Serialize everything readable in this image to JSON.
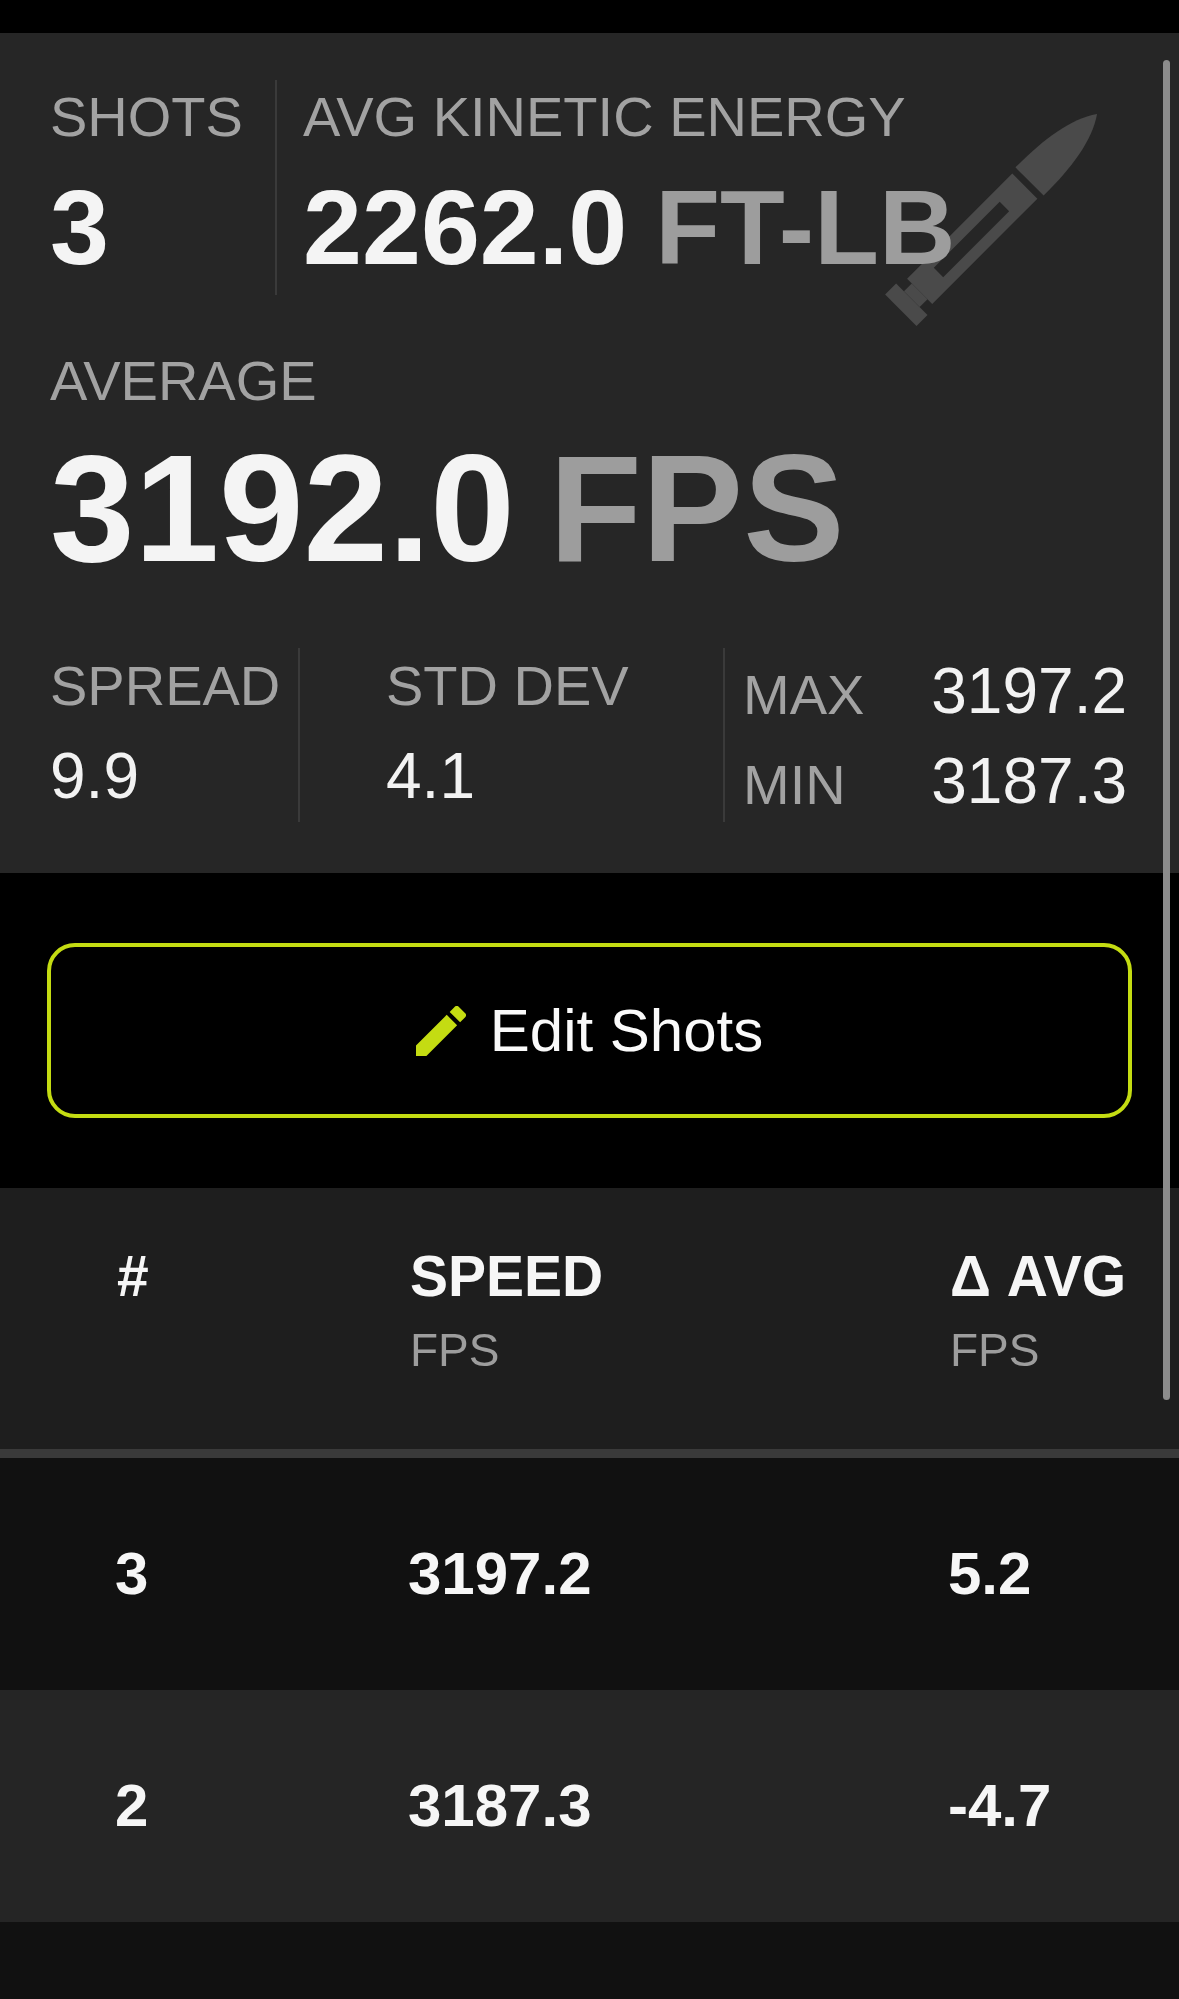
{
  "summary": {
    "shots": {
      "label": "SHOTS",
      "value": "3"
    },
    "kinetic_energy": {
      "label": "AVG KINETIC ENERGY",
      "value": "2262.0",
      "unit": "FT-LB"
    },
    "average": {
      "label": "AVERAGE",
      "value": "3192.0",
      "unit": "FPS"
    },
    "stats": [
      {
        "label": "SPREAD",
        "value": "9.9"
      },
      {
        "label": "STD DEV",
        "value": "4.1"
      }
    ],
    "extremes": [
      {
        "label": "MAX",
        "value": "3197.2"
      },
      {
        "label": "MIN",
        "value": "3187.3"
      }
    ]
  },
  "edit_button": {
    "label": "Edit Shots"
  },
  "table": {
    "columns": [
      {
        "label": "#"
      },
      {
        "label": "SPEED",
        "unit": "FPS"
      },
      {
        "label": "Δ AVG",
        "unit": "FPS"
      }
    ],
    "rows": [
      {
        "cells": [
          "3",
          "3197.2",
          "5.2"
        ]
      },
      {
        "cells": [
          "2",
          "3187.3",
          "-4.7"
        ]
      }
    ]
  }
}
